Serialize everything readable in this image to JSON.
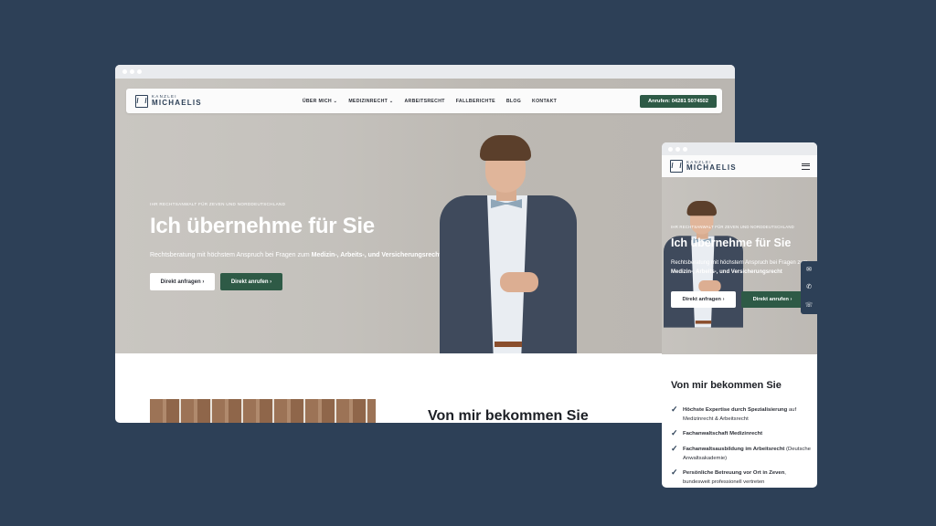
{
  "brand": {
    "small": "KANZLEI",
    "name": "MICHAELIS"
  },
  "nav": {
    "items": [
      "ÜBER MICH",
      "MEDIZINRECHT",
      "ARBEITSRECHT",
      "FALLBERICHTE",
      "BLOG",
      "KONTAKT"
    ],
    "call_button": "Anrufen: 04281 5074502"
  },
  "hero": {
    "kicker": "IHR RECHTSANWALT FÜR ZEVEN UND NORDDEUTSCHLAND",
    "title": "Ich übernehme für Sie",
    "subtitle_plain": "Rechtsberatung mit höchstem Anspruch bei Fragen zum ",
    "subtitle_bold": "Medizin-, Arbeits-, und Versicherungsrecht",
    "btn_request": "Direkt anfragen",
    "btn_call": "Direkt anrufen",
    "btn_chevron": "›"
  },
  "section": {
    "heading": "Von mir bekommen Sie"
  },
  "mobile": {
    "menu_icon": "hamburger-icon",
    "side_ctas": [
      "✉",
      "✆",
      "☏"
    ],
    "features": [
      {
        "bold": "Höchste Expertise durch Spezialisierung",
        "rest": " auf Medizinrecht & Arbeitsrecht"
      },
      {
        "bold": "Fachanwaltschaft Medizinrecht",
        "rest": ""
      },
      {
        "bold": "Fachanwaltsausbildung im Arbeitsrecht",
        "rest": " (Deutsche Anwaltsakademie)"
      },
      {
        "bold": "Persönliche Betreuung vor Ort in Zeven",
        "rest": ", bundesweit professionell vertreten"
      }
    ]
  },
  "colors": {
    "background": "#2d4057",
    "accent_green": "#2e5a46",
    "navy": "#2d4057"
  }
}
